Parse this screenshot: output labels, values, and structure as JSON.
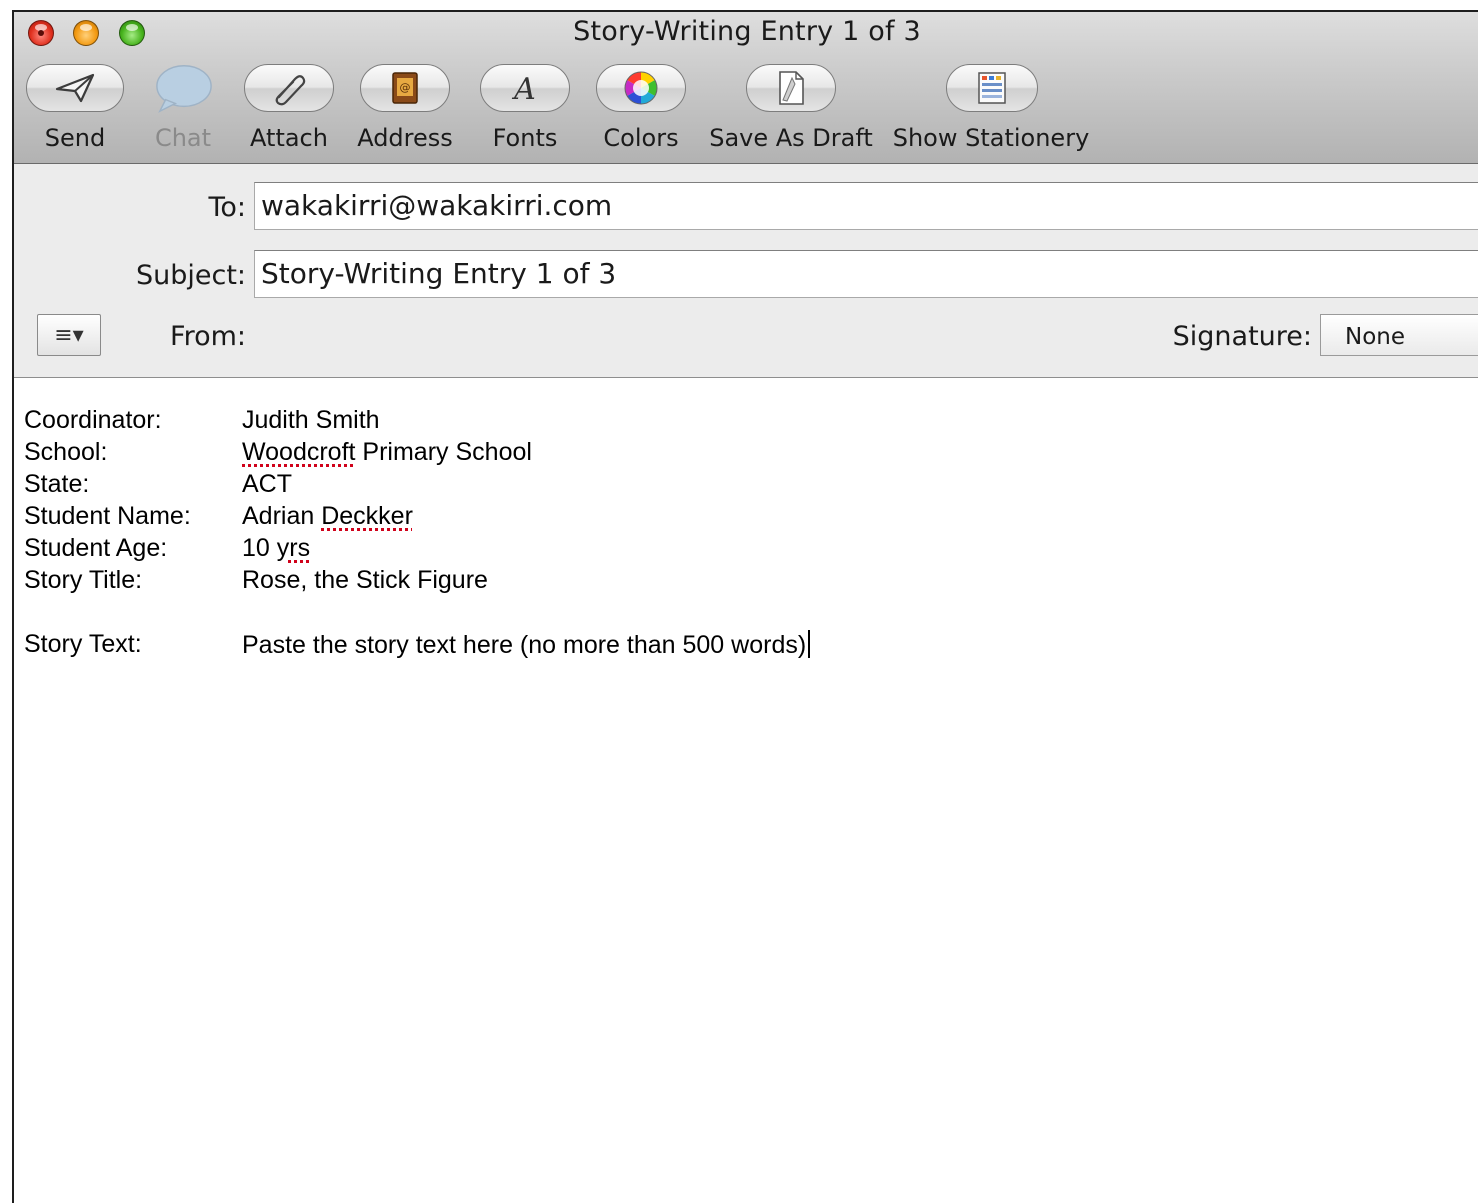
{
  "window": {
    "title": "Story-Writing Entry 1 of 3"
  },
  "toolbar": {
    "send": "Send",
    "chat": "Chat",
    "attach": "Attach",
    "address": "Address",
    "fonts": "Fonts",
    "colors": "Colors",
    "save_draft": "Save As Draft",
    "stationery": "Show Stationery"
  },
  "header": {
    "to_label": "To:",
    "to_value": "wakakirri@wakakirri.com",
    "subject_label": "Subject:",
    "subject_value": "Story-Writing Entry 1 of 3",
    "from_label": "From:",
    "signature_label": "Signature:",
    "signature_value": "None",
    "menu_glyph": "≡▾"
  },
  "message": {
    "coordinator_label": "Coordinator:",
    "coordinator_value": "Judith Smith",
    "school_label": "School:",
    "school_word": "Woodcroft",
    "school_rest": " Primary School",
    "state_label": "State:",
    "state_value": "ACT",
    "name_label": "Student Name:",
    "name_first": "Adrian ",
    "name_last": "Deckker",
    "age_label": "Student Age:",
    "age_num": "10 ",
    "age_unit": "yrs",
    "title_label": "Story Title:",
    "title_value": "Rose, the Stick Figure",
    "text_label": "Story Text:",
    "text_value": "Paste the story text here (no more than 500 words)"
  },
  "icons": {
    "send": "paper-plane-icon",
    "chat": "speech-bubble-icon",
    "attach": "paperclip-icon",
    "address": "address-book-icon",
    "fonts": "font-letter-icon",
    "colors": "color-wheel-icon",
    "save_draft": "draft-document-icon",
    "stationery": "stationery-icon"
  }
}
